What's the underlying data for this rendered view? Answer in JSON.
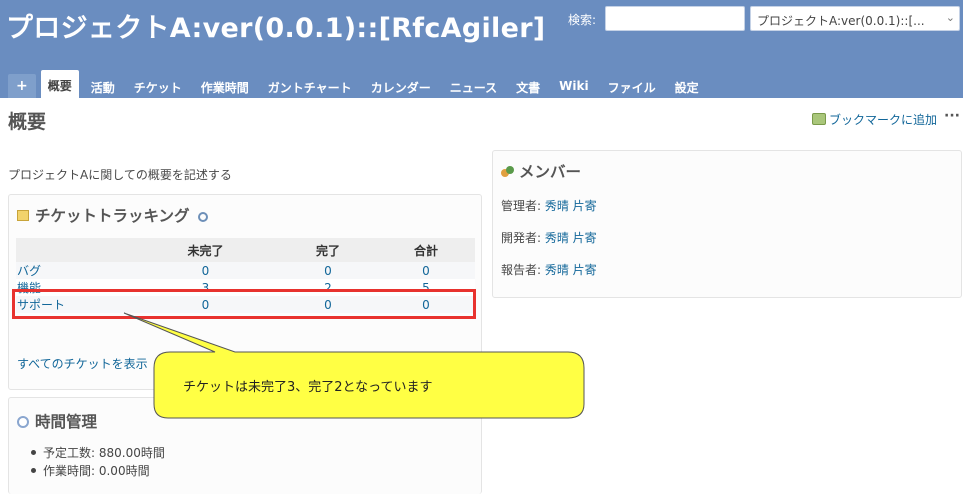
{
  "header": {
    "project_title": "プロジェクトA:ver(0.0.1)::[RfcAgiler]",
    "search_label": "検索:",
    "search_value": "",
    "project_select": "プロジェクトA:ver(0.0.1)::[..."
  },
  "tabs": [
    {
      "label": "+"
    },
    {
      "label": "概要"
    },
    {
      "label": "活動"
    },
    {
      "label": "チケット"
    },
    {
      "label": "作業時間"
    },
    {
      "label": "ガントチャート"
    },
    {
      "label": "カレンダー"
    },
    {
      "label": "ニュース"
    },
    {
      "label": "文書"
    },
    {
      "label": "Wiki"
    },
    {
      "label": "ファイル"
    },
    {
      "label": "設定"
    }
  ],
  "selected_tab": "概要",
  "page": {
    "title": "概要",
    "bookmark_label": "ブックマークに追加",
    "more": "···",
    "description": "プロジェクトAに関しての概要を記述する"
  },
  "ticket_tracking": {
    "title": "チケットトラッキング",
    "columns": [
      "",
      "未完了",
      "完了",
      "合計"
    ],
    "rows": [
      {
        "label": "バグ",
        "open": "0",
        "closed": "0",
        "total": "0"
      },
      {
        "label": "機能",
        "open": "3",
        "closed": "2",
        "total": "5"
      },
      {
        "label": "サポート",
        "open": "0",
        "closed": "0",
        "total": "0"
      }
    ],
    "view_all": "すべてのチケットを表示"
  },
  "time_management": {
    "title": "時間管理",
    "estimated_label": "予定工数: 880.00時間",
    "spent_label": "作業時間: 0.00時間"
  },
  "members": {
    "title": "メンバー",
    "rows": [
      {
        "role": "管理者: ",
        "name": "秀晴 片寄"
      },
      {
        "role": "開発者: ",
        "name": "秀晴 片寄"
      },
      {
        "role": "報告者: ",
        "name": "秀晴 片寄"
      }
    ]
  },
  "annotation": {
    "callout_text": "チケットは未完了3、完了2となっています"
  },
  "colors": {
    "header_bg": "#6a8dc0",
    "link": "#116699",
    "highlight_border": "#e8322e",
    "callout_fill": "#ffff44"
  }
}
